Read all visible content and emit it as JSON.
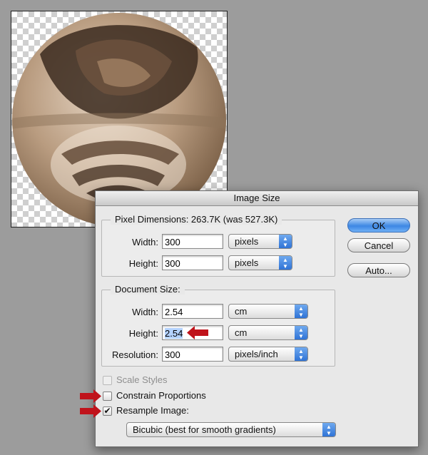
{
  "dialog": {
    "title": "Image Size",
    "pixel_dimensions": {
      "title": "Pixel Dimensions:  263.7K (was 527.3K)",
      "width_label": "Width:",
      "width_value": "300",
      "width_unit": "pixels",
      "height_label": "Height:",
      "height_value": "300",
      "height_unit": "pixels"
    },
    "document_size": {
      "title": "Document Size:",
      "width_label": "Width:",
      "width_value": "2.54",
      "width_unit": "cm",
      "height_label": "Height:",
      "height_value": "2.54",
      "height_unit": "cm",
      "resolution_label": "Resolution:",
      "resolution_value": "300",
      "resolution_unit": "pixels/inch"
    },
    "buttons": {
      "ok": "OK",
      "cancel": "Cancel",
      "auto": "Auto..."
    },
    "options": {
      "scale_styles": "Scale Styles",
      "scale_styles_checked": false,
      "scale_styles_enabled": false,
      "constrain_proportions": "Constrain Proportions",
      "constrain_checked": false,
      "resample_image": "Resample Image:",
      "resample_checked": true,
      "resample_method": "Bicubic (best for smooth gradients)"
    }
  },
  "colors": {
    "annotation_arrow": "#c0131b",
    "default_button": "#3d87e4",
    "popup_arrow": "#2f73d6"
  }
}
